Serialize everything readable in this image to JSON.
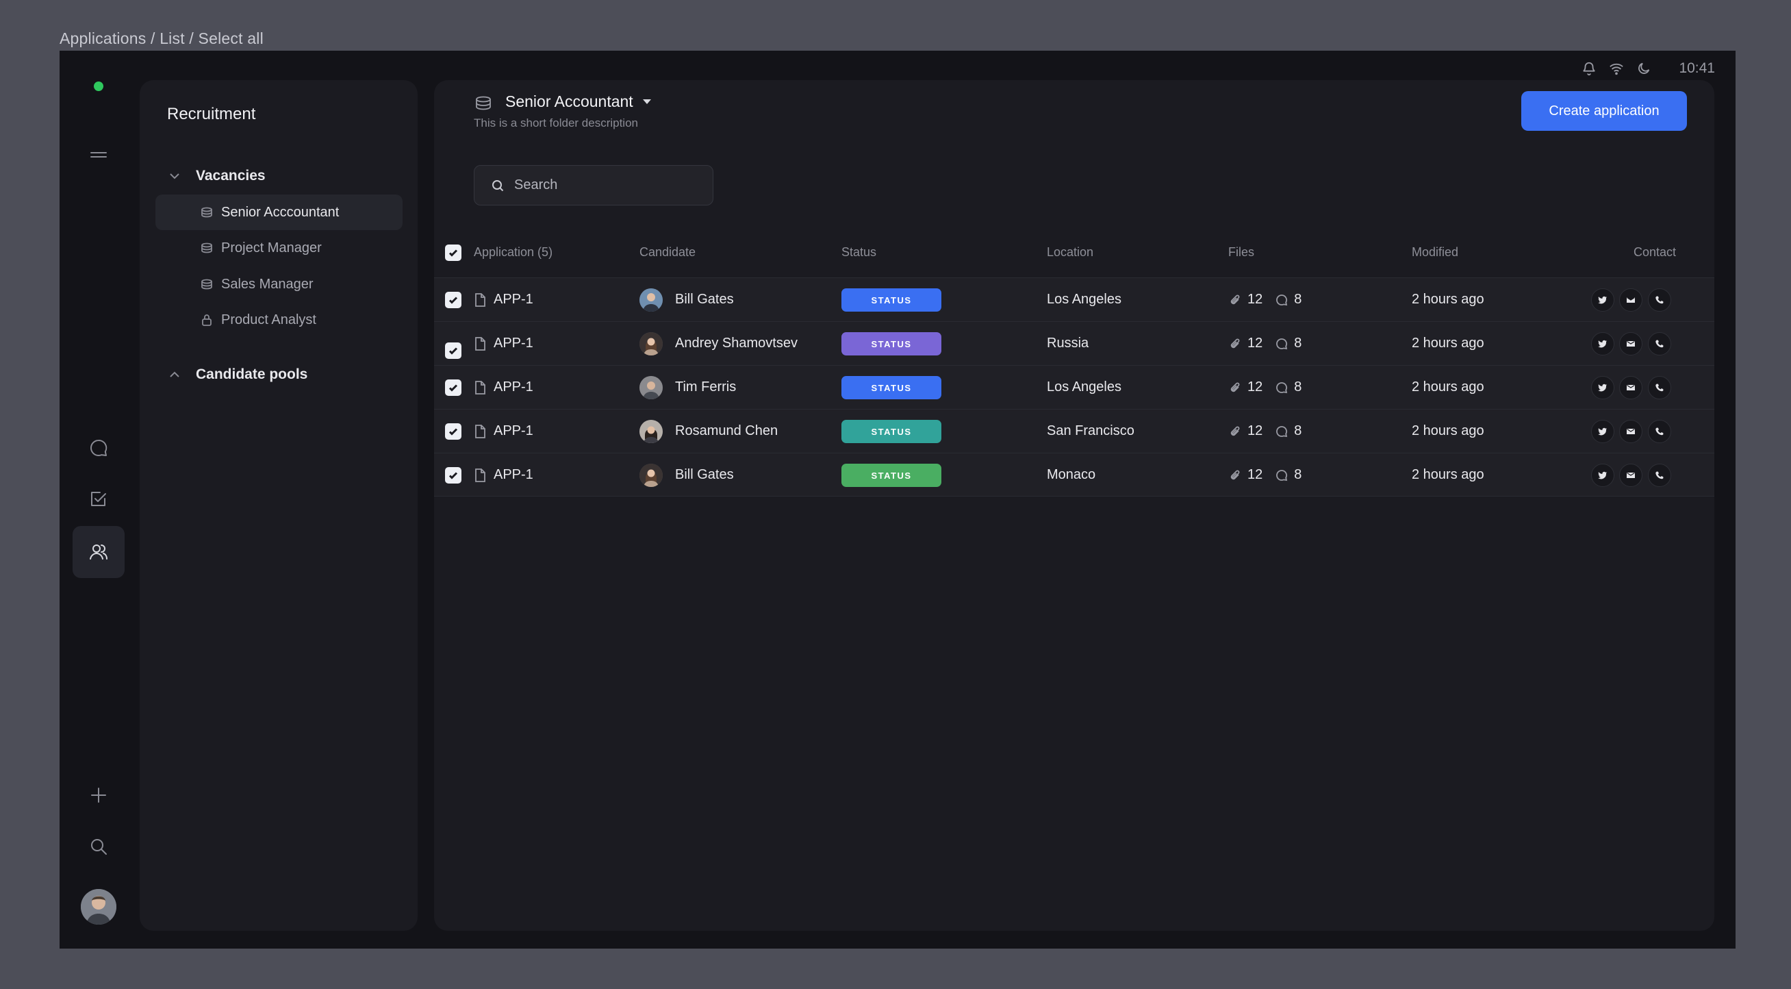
{
  "breadcrumb": "Applications / List / Select all",
  "status_bar": {
    "time": "10:41"
  },
  "rail": {
    "status_color": "#2fc85e"
  },
  "sidebar": {
    "title": "Recruitment",
    "vacancies_label": "Vacancies",
    "items": [
      {
        "label": "Senior Acccountant",
        "icon": "folder-icon",
        "active": true
      },
      {
        "label": "Project Manager",
        "icon": "folder-icon"
      },
      {
        "label": "Sales Manager",
        "icon": "folder-icon"
      },
      {
        "label": "Product Analyst",
        "icon": "lock-icon"
      }
    ],
    "pools_label": "Candidate pools"
  },
  "main": {
    "folder_title": "Senior Accountant",
    "folder_description": "This is a short folder description",
    "create_button": "Create application",
    "search_placeholder": "Search"
  },
  "table": {
    "headers": {
      "application": "Application (5)",
      "candidate": "Candidate",
      "status": "Status",
      "location": "Location",
      "files": "Files",
      "modified": "Modified",
      "contact": "Contact"
    },
    "rows": [
      {
        "id": "APP-1",
        "candidate": "Bill Gates",
        "status": "STATUS",
        "status_color": "#3a6ff2",
        "location": "Los Angeles",
        "files": "12",
        "comments": "8",
        "modified": "2 hours ago"
      },
      {
        "id": "APP-1",
        "candidate": "Andrey Shamovtsev",
        "status": "STATUS",
        "status_color": "#7a66d6",
        "location": "Russia",
        "files": "12",
        "comments": "8",
        "modified": "2 hours ago"
      },
      {
        "id": "APP-1",
        "candidate": "Tim Ferris",
        "status": "STATUS",
        "status_color": "#3a6ff2",
        "location": "Los Angeles",
        "files": "12",
        "comments": "8",
        "modified": "2 hours ago"
      },
      {
        "id": "APP-1",
        "candidate": "Rosamund Chen",
        "status": "STATUS",
        "status_color": "#31a39a",
        "location": "San Francisco",
        "files": "12",
        "comments": "8",
        "modified": "2 hours ago"
      },
      {
        "id": "APP-1",
        "candidate": "Bill Gates",
        "status": "STATUS",
        "status_color": "#4aae62",
        "location": "Monaco",
        "files": "12",
        "comments": "8",
        "modified": "2 hours ago"
      }
    ]
  }
}
